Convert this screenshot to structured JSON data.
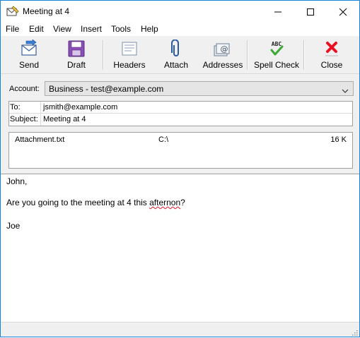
{
  "window": {
    "title": "Meeting at 4"
  },
  "menu": [
    "File",
    "Edit",
    "View",
    "Insert",
    "Tools",
    "Help"
  ],
  "toolbar": {
    "send": "Send",
    "draft": "Draft",
    "headers": "Headers",
    "attach": "Attach",
    "addresses": "Addresses",
    "spell_check": "Spell Check",
    "spell_icon_text": "ABC",
    "close": "Close"
  },
  "header": {
    "account_label": "Account:",
    "account_value": "Business - test@example.com",
    "to_label": "To:",
    "to_value": "jsmith@example.com",
    "subject_label": "Subject:",
    "subject_value": "Meeting at 4"
  },
  "attachments": [
    {
      "name": "Attachment.txt",
      "path": "C:\\",
      "size": "16 K"
    }
  ],
  "body": {
    "greeting": "John,",
    "line_prefix": "Are you going to the meeting at 4 this ",
    "misspelled_word": "afternon",
    "line_suffix": "?",
    "signature": "Joe"
  },
  "colors": {
    "accent_border": "#1883d7",
    "spell_error": "#e81123",
    "close_icon": "#e81123",
    "check_icon": "#3aa935"
  }
}
